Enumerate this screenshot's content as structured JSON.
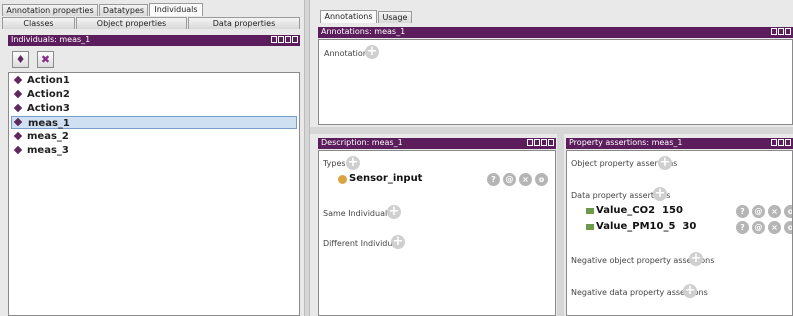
{
  "left": {
    "tabs_top": [
      "Annotation properties",
      "Datatypes",
      "Individuals"
    ],
    "tabs_bottom": [
      "Classes",
      "Object properties",
      "Data properties"
    ],
    "header": "Individuals: meas_1",
    "tools": {
      "add": "♦",
      "delete": "✖"
    },
    "individuals": [
      {
        "label": "Action1",
        "selected": false
      },
      {
        "label": "Action2",
        "selected": false
      },
      {
        "label": "Action3",
        "selected": false
      },
      {
        "label": "meas_1",
        "selected": true
      },
      {
        "label": "meas_2",
        "selected": false
      },
      {
        "label": "meas_3",
        "selected": false
      }
    ]
  },
  "right": {
    "tabs": [
      "Annotations",
      "Usage"
    ],
    "annotations_header": "Annotations: meas_1",
    "annotations_label": "Annotations",
    "description": {
      "header": "Description: meas_1",
      "types_label": "Types",
      "type_value": "Sensor_input",
      "same_label": "Same Individual As",
      "different_label": "Different Individuals"
    },
    "property_assertions": {
      "header": "Property assertions: meas_1",
      "object_label": "Object property assertions",
      "data_label": "Data property assertions",
      "data_values": [
        {
          "property": "Value_CO2",
          "value": "150"
        },
        {
          "property": "Value_PM10_5",
          "value": "30"
        }
      ],
      "neg_object_label": "Negative object property assertions",
      "neg_data_label": "Negative data property assertions"
    },
    "button_glyphs": {
      "info": "?",
      "annotate": "@",
      "delete": "×",
      "edit": "o",
      "add": "+"
    }
  },
  "colors": {
    "header": "#5b1d5c",
    "selection": "#cfe0f2",
    "class_dot": "#d9a441",
    "data_prop": "#6a9a4a"
  }
}
